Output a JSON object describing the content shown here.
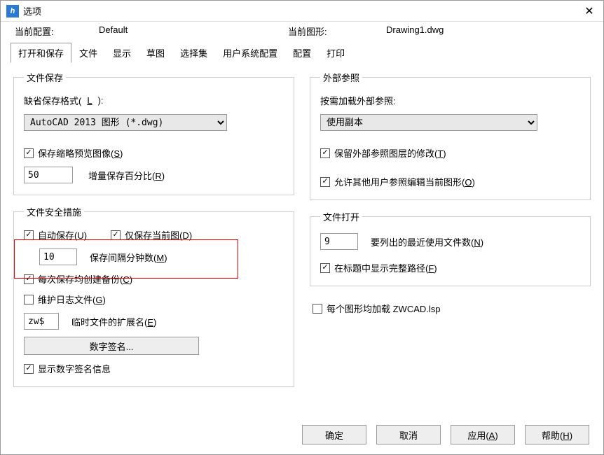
{
  "window": {
    "title": "选项"
  },
  "header": {
    "profile_label": "当前配置:",
    "profile_value": "Default",
    "drawing_label": "当前图形:",
    "drawing_value": "Drawing1.dwg"
  },
  "tabs": {
    "items": [
      "打开和保存",
      "文件",
      "显示",
      "草图",
      "选择集",
      "用户系统配置",
      "配置",
      "打印"
    ],
    "active": 0
  },
  "file_save": {
    "legend": "文件保存",
    "default_format_label": "缺省保存格式(L):",
    "default_format_value": "AutoCAD 2013 图形 (*.dwg)",
    "save_thumbnail": {
      "checked": true,
      "label": "保存缩略预览图像(S)"
    },
    "incremental_value": "50",
    "incremental_label": "增量保存百分比(R)"
  },
  "file_safety": {
    "legend": "文件安全措施",
    "autosave": {
      "checked": true,
      "label": "自动保存(U)"
    },
    "only_current": {
      "checked": true,
      "label": "仅保存当前图(D)"
    },
    "interval_value": "10",
    "interval_label": "保存间隔分钟数(M)",
    "backup_each": {
      "checked": true,
      "label": "每次保存均创建备份(C)"
    },
    "maintain_log": {
      "checked": false,
      "label": "维护日志文件(G)"
    },
    "temp_ext_value": "zw$",
    "temp_ext_label": "临时文件的扩展名(E)",
    "digital_sig_btn": "数字签名...",
    "show_sig": {
      "checked": true,
      "label": "显示数字签名信息"
    }
  },
  "external_ref": {
    "legend": "外部参照",
    "on_demand_label": "按需加载外部参照:",
    "on_demand_value": "使用副本",
    "retain_changes": {
      "checked": true,
      "label": "保留外部参照图层的修改(T)"
    },
    "allow_edit": {
      "checked": true,
      "label": "允许其他用户参照编辑当前图形(O)"
    }
  },
  "file_open": {
    "legend": "文件打开",
    "recent_count_value": "9",
    "recent_count_label": "要列出的最近使用文件数(N)",
    "show_full_path": {
      "checked": true,
      "label": "在标题中显示完整路径(F)"
    }
  },
  "misc": {
    "load_lsp": {
      "checked": false,
      "label": "每个图形均加载 ZWCAD.lsp"
    }
  },
  "footer": {
    "ok": "确定",
    "cancel": "取消",
    "apply": "应用(A)",
    "help": "帮助(H)"
  }
}
